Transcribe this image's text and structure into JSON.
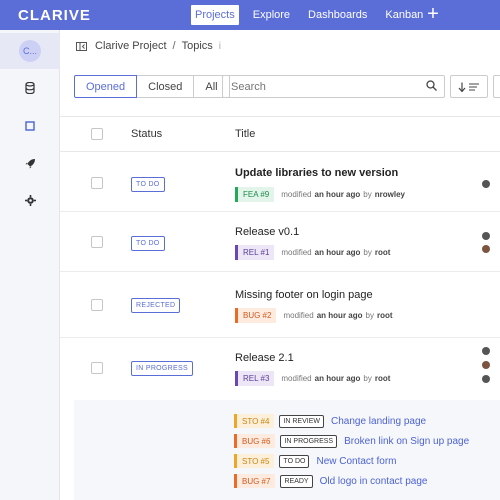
{
  "app": {
    "logo": "CLARIVE"
  },
  "topnav": {
    "items": [
      {
        "label": "Projects",
        "active": true
      },
      {
        "label": "Explore",
        "active": false
      },
      {
        "label": "Dashboards",
        "active": false
      },
      {
        "label": "Kanban",
        "active": false
      }
    ],
    "add_label": "+"
  },
  "sidebar": {
    "project_avatar": "C...",
    "icons": [
      "database-icon",
      "square-icon",
      "rocket-icon",
      "gear-icon"
    ]
  },
  "breadcrumb": {
    "project": "Clarive Project",
    "separator": "/",
    "page": "Topics",
    "info": "i"
  },
  "filters": {
    "opened": "Opened",
    "closed": "Closed",
    "all": "All",
    "active": "opened"
  },
  "search": {
    "placeholder": "Search",
    "value": ""
  },
  "table": {
    "headers": {
      "status": "Status",
      "title": "Title"
    },
    "rows": [
      {
        "status": "TO DO",
        "title": "Update libraries to new version",
        "bold": true,
        "tag": "FEA #9",
        "tag_type": "fea",
        "modified": "modified",
        "when": "an hour ago",
        "by": "by",
        "user": "nrowley"
      },
      {
        "status": "TO DO",
        "title": "Release v0.1",
        "bold": false,
        "tag": "REL #1",
        "tag_type": "rel",
        "modified": "modified",
        "when": "an hour ago",
        "by": "by",
        "user": "root"
      },
      {
        "status": "REJECTED",
        "title": "Missing footer on login page",
        "bold": false,
        "tag": "BUG #2",
        "tag_type": "bug",
        "modified": "modified",
        "when": "an hour ago",
        "by": "by",
        "user": "root"
      },
      {
        "status": "IN PROGRESS",
        "title": "Release 2.1",
        "bold": false,
        "tag": "REL #3",
        "tag_type": "rel",
        "modified": "modified",
        "when": "an hour ago",
        "by": "by",
        "user": "root"
      }
    ],
    "children": [
      {
        "tag": "STO #4",
        "tag_type": "sto",
        "status": "IN REVIEW",
        "title": "Change landing page"
      },
      {
        "tag": "BUG #6",
        "tag_type": "bug",
        "status": "IN PROGRESS",
        "title": "Broken link on Sign up page"
      },
      {
        "tag": "STO #5",
        "tag_type": "sto",
        "status": "TO DO",
        "title": "New Contact form"
      },
      {
        "tag": "BUG #7",
        "tag_type": "bug",
        "status": "READY",
        "title": "Old logo in contact page"
      }
    ]
  },
  "colors": {
    "brand": "#5b6ed8",
    "link": "#4c63d2"
  }
}
